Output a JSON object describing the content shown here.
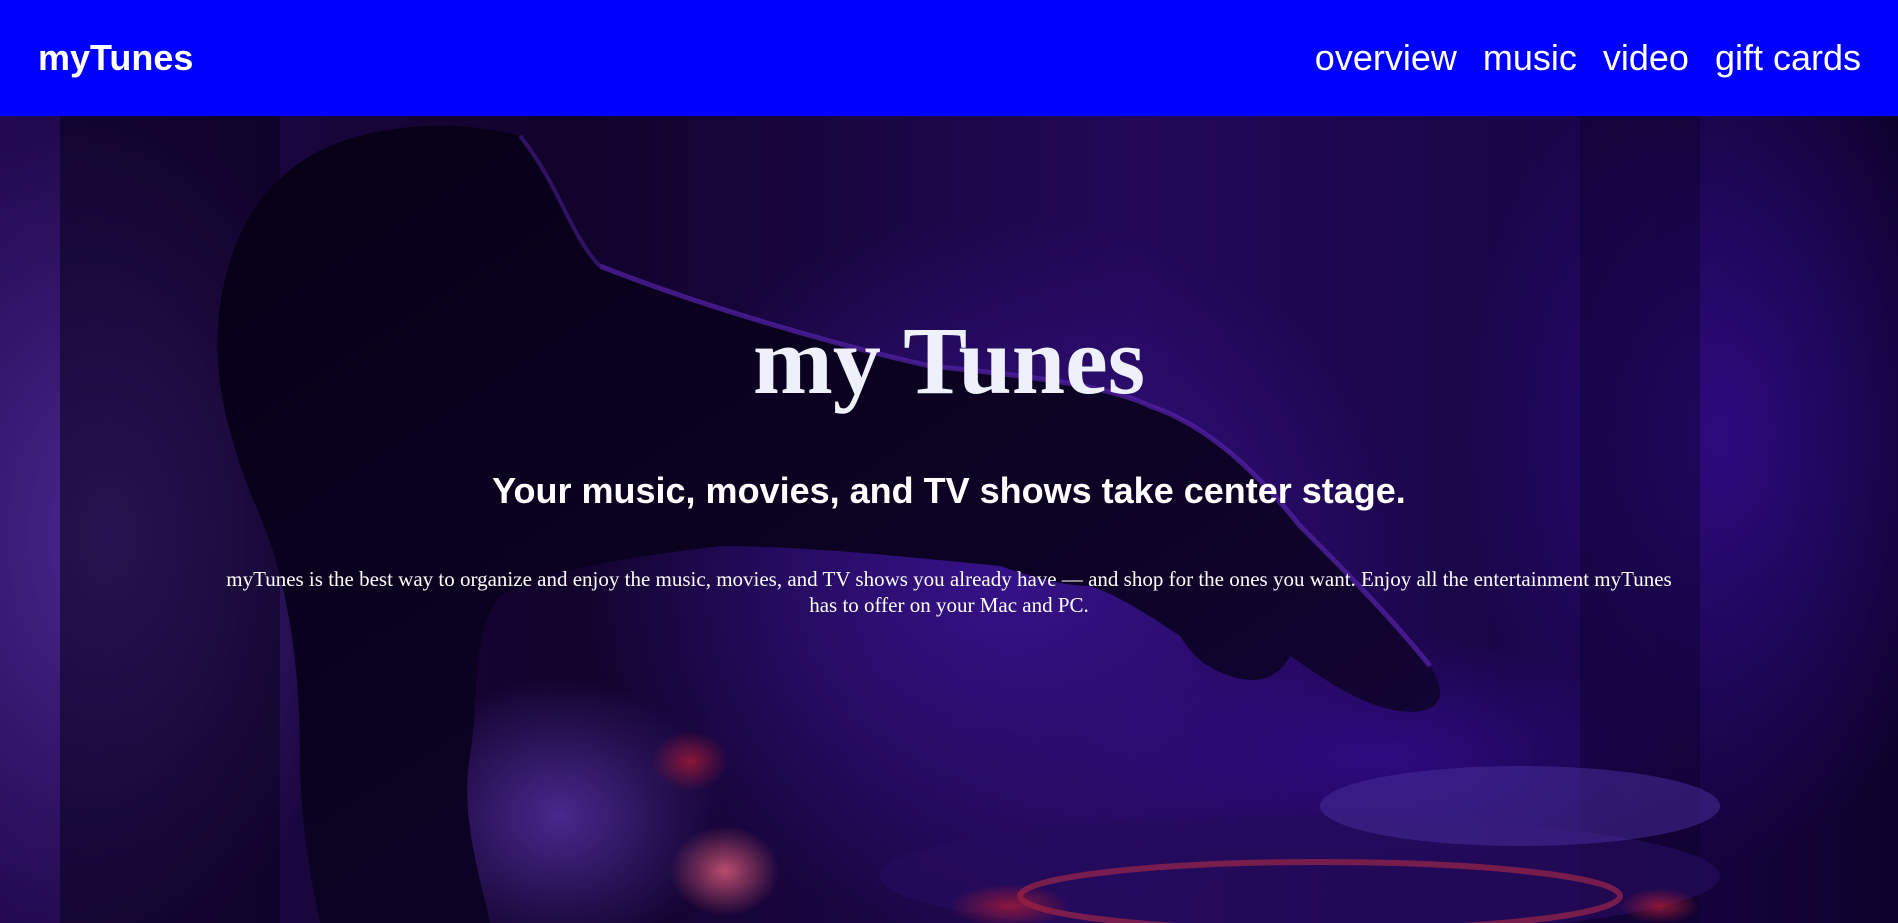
{
  "navbar": {
    "brand": "myTunes",
    "links": [
      {
        "label": "overview"
      },
      {
        "label": "music"
      },
      {
        "label": "video"
      },
      {
        "label": "gift cards"
      }
    ],
    "background_color": "#0000ff"
  },
  "hero": {
    "title": "my Tunes",
    "subtitle": "Your music, movies, and TV shows take center stage.",
    "description": "myTunes is the best way to organize and enjoy the music, movies, and TV shows you already have — and shop for the ones you want. Enjoy all the entertainment myTunes has to offer on your Mac and PC.",
    "background_image": "dj-hand-over-turntable-purple-photo"
  }
}
